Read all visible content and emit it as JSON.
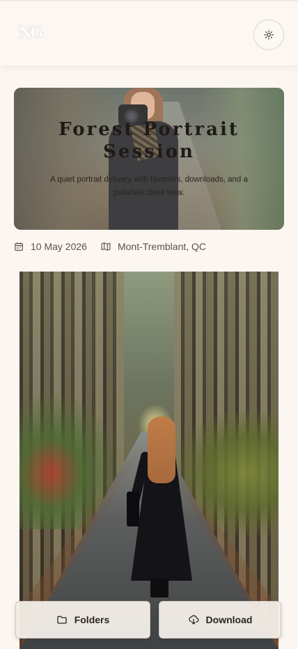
{
  "header": {
    "logo_text": "NG",
    "theme_toggle_icon": "sun-icon"
  },
  "hero": {
    "title": "Forest Portrait Session",
    "description": "A quiet portrait delivery with favorites, downloads, and a polished client view."
  },
  "meta": {
    "date": "10 May 2026",
    "date_icon": "calendar-icon",
    "location": "Mont-Tremblant, QC",
    "location_icon": "map-icon"
  },
  "actions": {
    "folders_label": "Folders",
    "folders_icon": "folder-icon",
    "download_label": "Download",
    "download_icon": "cloud-download-icon"
  },
  "colors": {
    "background": "#fbf6f1",
    "text": "#3b3430"
  }
}
